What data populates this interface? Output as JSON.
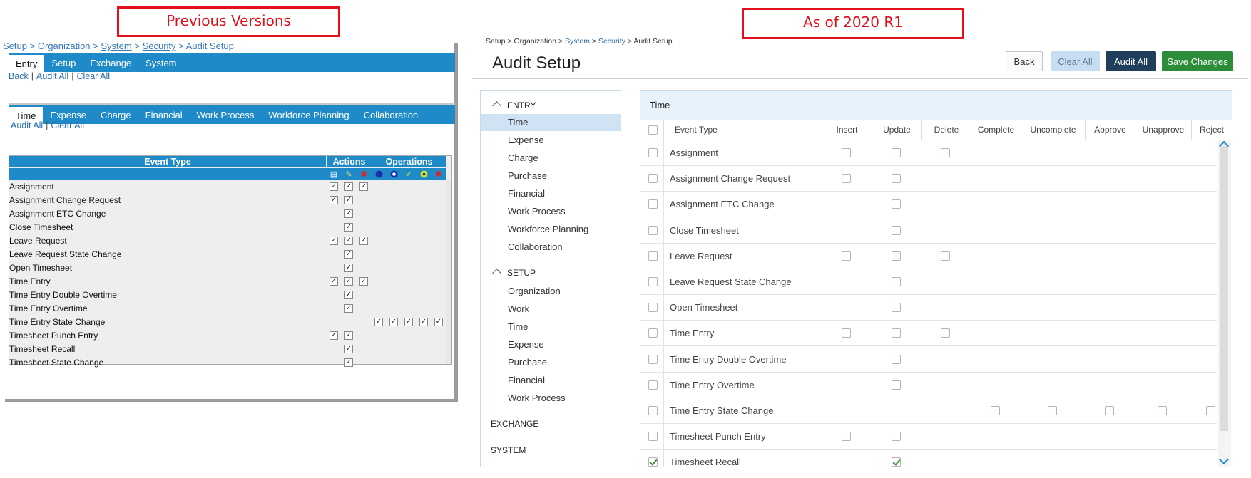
{
  "captions": {
    "left": "Previous Versions",
    "right": "As of 2020 R1"
  },
  "old_ui": {
    "breadcrumb": {
      "setup": "Setup",
      "sep": ">",
      "organization": "Organization",
      "system": "System",
      "security": "Security",
      "page": "Audit Setup"
    },
    "top_tabs": [
      "Entry",
      "Setup",
      "Exchange",
      "System"
    ],
    "top_links": {
      "back": "Back",
      "audit_all": "Audit All",
      "clear_all": "Clear All",
      "sep": "|"
    },
    "sub_tabs": [
      "Time",
      "Expense",
      "Charge",
      "Financial",
      "Work Process",
      "Workforce Planning",
      "Collaboration"
    ],
    "sub_links": {
      "audit_all": "Audit All",
      "clear_all": "Clear All",
      "sep": "|"
    },
    "grid_headers": {
      "event_type": "Event Type",
      "actions": "Actions",
      "operations": "Operations"
    },
    "rows": [
      {
        "label": "Assignment",
        "checks": [
          1,
          1,
          1,
          0,
          0,
          0,
          0,
          0
        ]
      },
      {
        "label": "Assignment Change Request",
        "checks": [
          1,
          1,
          0,
          0,
          0,
          0,
          0,
          0
        ]
      },
      {
        "label": "Assignment ETC Change",
        "checks": [
          0,
          1,
          0,
          0,
          0,
          0,
          0,
          0
        ]
      },
      {
        "label": "Close Timesheet",
        "checks": [
          0,
          1,
          0,
          0,
          0,
          0,
          0,
          0
        ]
      },
      {
        "label": "Leave Request",
        "checks": [
          1,
          1,
          1,
          0,
          0,
          0,
          0,
          0
        ]
      },
      {
        "label": "Leave Request State Change",
        "checks": [
          0,
          1,
          0,
          0,
          0,
          0,
          0,
          0
        ]
      },
      {
        "label": "Open Timesheet",
        "checks": [
          0,
          1,
          0,
          0,
          0,
          0,
          0,
          0
        ]
      },
      {
        "label": "Time Entry",
        "checks": [
          1,
          1,
          1,
          0,
          0,
          0,
          0,
          0
        ]
      },
      {
        "label": "Time Entry Double Overtime",
        "checks": [
          0,
          1,
          0,
          0,
          0,
          0,
          0,
          0
        ]
      },
      {
        "label": "Time Entry Overtime",
        "checks": [
          0,
          1,
          0,
          0,
          0,
          0,
          0,
          0
        ]
      },
      {
        "label": "Time Entry State Change",
        "checks": [
          0,
          0,
          0,
          1,
          1,
          1,
          1,
          1
        ]
      },
      {
        "label": "Timesheet Punch Entry",
        "checks": [
          1,
          1,
          0,
          0,
          0,
          0,
          0,
          0
        ]
      },
      {
        "label": "Timesheet Recall",
        "checks": [
          0,
          1,
          0,
          0,
          0,
          0,
          0,
          0
        ]
      },
      {
        "label": "Timesheet State Change",
        "checks": [
          0,
          1,
          0,
          0,
          0,
          0,
          0,
          0
        ]
      }
    ]
  },
  "new_ui": {
    "breadcrumb": {
      "setup": "Setup",
      "sep": ">",
      "organization": "Organization",
      "system": "System",
      "security": "Security",
      "page": "Audit Setup"
    },
    "title": "Audit Setup",
    "buttons": {
      "back": "Back",
      "clear_all": "Clear All",
      "audit_all": "Audit All",
      "save": "Save Changes"
    },
    "nav": {
      "entry": {
        "label": "ENTRY",
        "items": [
          "Time",
          "Expense",
          "Charge",
          "Purchase",
          "Financial",
          "Work Process",
          "Workforce Planning",
          "Collaboration"
        ]
      },
      "setup": {
        "label": "SETUP",
        "items": [
          "Organization",
          "Work",
          "Time",
          "Expense",
          "Purchase",
          "Financial",
          "Work Process"
        ]
      },
      "exchange": {
        "label": "EXCHANGE"
      },
      "system": {
        "label": "SYSTEM"
      }
    },
    "grid": {
      "title": "Time",
      "columns": [
        "Event Type",
        "Insert",
        "Update",
        "Delete",
        "Complete",
        "Uncomplete",
        "Approve",
        "Unapprove",
        "Reject"
      ],
      "rows": [
        {
          "label": "Assignment",
          "cells": [
            "off",
            "off",
            "off",
            null,
            null,
            null,
            null,
            null
          ],
          "row_checked": false
        },
        {
          "label": "Assignment Change Request",
          "cells": [
            "off",
            "off",
            null,
            null,
            null,
            null,
            null,
            null
          ],
          "row_checked": false
        },
        {
          "label": "Assignment ETC Change",
          "cells": [
            null,
            "off",
            null,
            null,
            null,
            null,
            null,
            null
          ],
          "row_checked": false
        },
        {
          "label": "Close Timesheet",
          "cells": [
            null,
            "off",
            null,
            null,
            null,
            null,
            null,
            null
          ],
          "row_checked": false
        },
        {
          "label": "Leave Request",
          "cells": [
            "off",
            "off",
            "off",
            null,
            null,
            null,
            null,
            null
          ],
          "row_checked": false
        },
        {
          "label": "Leave Request State Change",
          "cells": [
            null,
            "off",
            null,
            null,
            null,
            null,
            null,
            null
          ],
          "row_checked": false
        },
        {
          "label": "Open Timesheet",
          "cells": [
            null,
            "off",
            null,
            null,
            null,
            null,
            null,
            null
          ],
          "row_checked": false
        },
        {
          "label": "Time Entry",
          "cells": [
            "off",
            "off",
            "off",
            null,
            null,
            null,
            null,
            null
          ],
          "row_checked": false
        },
        {
          "label": "Time Entry Double Overtime",
          "cells": [
            null,
            "off",
            null,
            null,
            null,
            null,
            null,
            null
          ],
          "row_checked": false
        },
        {
          "label": "Time Entry Overtime",
          "cells": [
            null,
            "off",
            null,
            null,
            null,
            null,
            null,
            null
          ],
          "row_checked": false
        },
        {
          "label": "Time Entry State Change",
          "cells": [
            null,
            null,
            null,
            "off",
            "off",
            "off",
            "off",
            "off"
          ],
          "row_checked": false
        },
        {
          "label": "Timesheet Punch Entry",
          "cells": [
            "off",
            "off",
            null,
            null,
            null,
            null,
            null,
            null
          ],
          "row_checked": false
        },
        {
          "label": "Timesheet Recall",
          "cells": [
            null,
            "on",
            null,
            null,
            null,
            null,
            null,
            null
          ],
          "row_checked": true
        }
      ]
    }
  },
  "colors": {
    "caption_red": "#e3101b",
    "old_tab_blue": "#1e8ac8",
    "save_green": "#2b8c3a",
    "audit_navy": "#1e3e5b"
  }
}
